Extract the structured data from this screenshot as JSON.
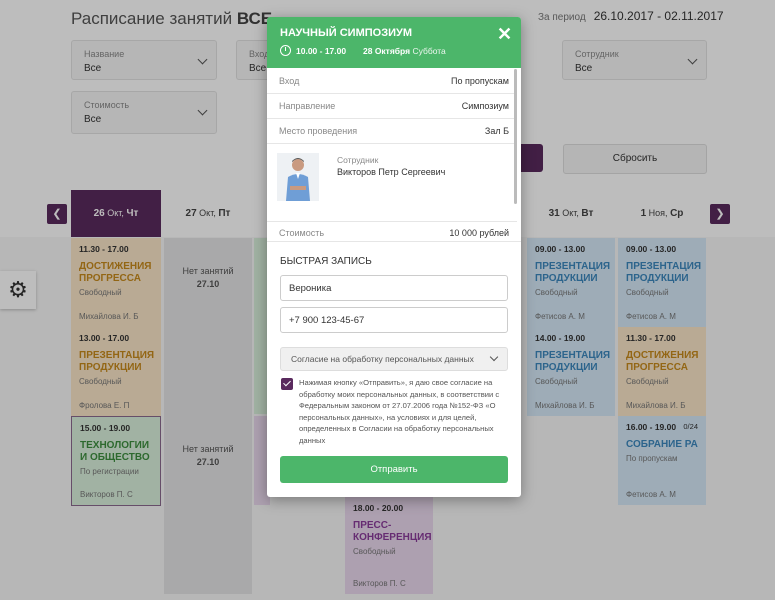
{
  "page": {
    "title": "Расписание занятий",
    "title_bold": "ВСЕ",
    "period_label": "За период",
    "period_value": "26.10.2017 - 02.11.2017"
  },
  "filters": [
    {
      "label": "Название",
      "value": "Все"
    },
    {
      "label": "Вход",
      "value": "Все"
    },
    {
      "label": "Сотрудник",
      "value": "Все"
    },
    {
      "label": "Стоимость",
      "value": "Все"
    }
  ],
  "reset_label": "Сбросить",
  "days": [
    {
      "num": "26",
      "mon": "Окт,",
      "wd": "Чт"
    },
    {
      "num": "27",
      "mon": "Окт,",
      "wd": "Пт"
    },
    {
      "num": "31",
      "mon": "Окт,",
      "wd": "Вт"
    },
    {
      "num": "1",
      "mon": "Ноя,",
      "wd": "Ср"
    }
  ],
  "events": {
    "e1": {
      "time": "11.30 - 17.00",
      "name": "ДОСТИЖЕНИЯ ПРОГРЕССА",
      "status": "Свободный",
      "person": "Михайлова И. Б"
    },
    "e2": {
      "time": "13.00 - 17.00",
      "name": "ПРЕЗЕНТАЦИЯ ПРОДУКЦИИ",
      "status": "Свободный",
      "person": "Фролова Е. П"
    },
    "e3": {
      "time": "15.00 - 19.00",
      "name": "ТЕХНОЛОГИИ И ОБЩЕСТВО",
      "status": "По регистрации",
      "person": "Викторов П. С"
    },
    "e4": {
      "time": "09.00 - 13.00",
      "name": "ПРЕЗЕНТАЦИЯ ПРОДУКЦИИ",
      "status": "Свободный",
      "person": "Фетисов А. М"
    },
    "e5": {
      "time": "14.00 - 19.00",
      "name": "ПРЕЗЕНТАЦИЯ ПРОДУКЦИИ",
      "status": "Свободный",
      "person": "Михайлова И. Б"
    },
    "e6": {
      "time": "09.00 - 13.00",
      "name": "ПРЕЗЕНТАЦИЯ ПРОДУКЦИИ",
      "status": "Свободный",
      "person": "Фетисов А. М"
    },
    "e7": {
      "time": "11.30 - 17.00",
      "name": "ДОСТИЖЕНИЯ ПРОГРЕССА",
      "status": "Свободный",
      "person": "Михайлова И. Б"
    },
    "e8": {
      "time": "16.00 - 19.00",
      "count": "0/24",
      "name": "СОБРАНИЕ РАЗРАБОТЧИКОІ",
      "status": "По пропускам",
      "person": "Фетисов А. М"
    },
    "e9": {
      "time": "18.00 - 20.00",
      "name": "ПРЕСС-КОНФЕРЕНЦИЯ",
      "status": "Свободный",
      "person": "Викторов П. С"
    }
  },
  "no_class": {
    "label": "Нет занятий",
    "date": "27.10"
  },
  "modal": {
    "title": "НАУЧНЫЙ СИМПОЗИУМ",
    "time": "10.00 - 17.00",
    "date": "28 Октября",
    "weekday": "Суббота",
    "rows": [
      {
        "key": "Вход",
        "value": "По пропускам"
      },
      {
        "key": "Направление",
        "value": "Симпозиум"
      },
      {
        "key": "Место проведения",
        "value": "Зал Б"
      }
    ],
    "staff_label": "Сотрудник",
    "staff_name": "Викторов Петр Сергеевич",
    "cost_label": "Стоимость",
    "cost_value": "10 000 рублей",
    "quick_title": "БЫСТРАЯ ЗАПИСЬ",
    "name_value": "Вероника",
    "phone_value": "+7 900 123-45-67",
    "consent_select": "Согласие на обработку персональных данных",
    "consent_text": "Нажимая кнопку «Отправить», я даю свое согласие на обработку моих персональных данных, в соответствии с Федеральным законом от 27.07.2006 года №152-ФЗ «О персональных данных», на условиях и для целей, определенных в Согласии на обработку персональных данных",
    "submit_label": "Отправить"
  },
  "colors": {
    "accent": "#5a2a5e",
    "green": "#4cb66a"
  }
}
